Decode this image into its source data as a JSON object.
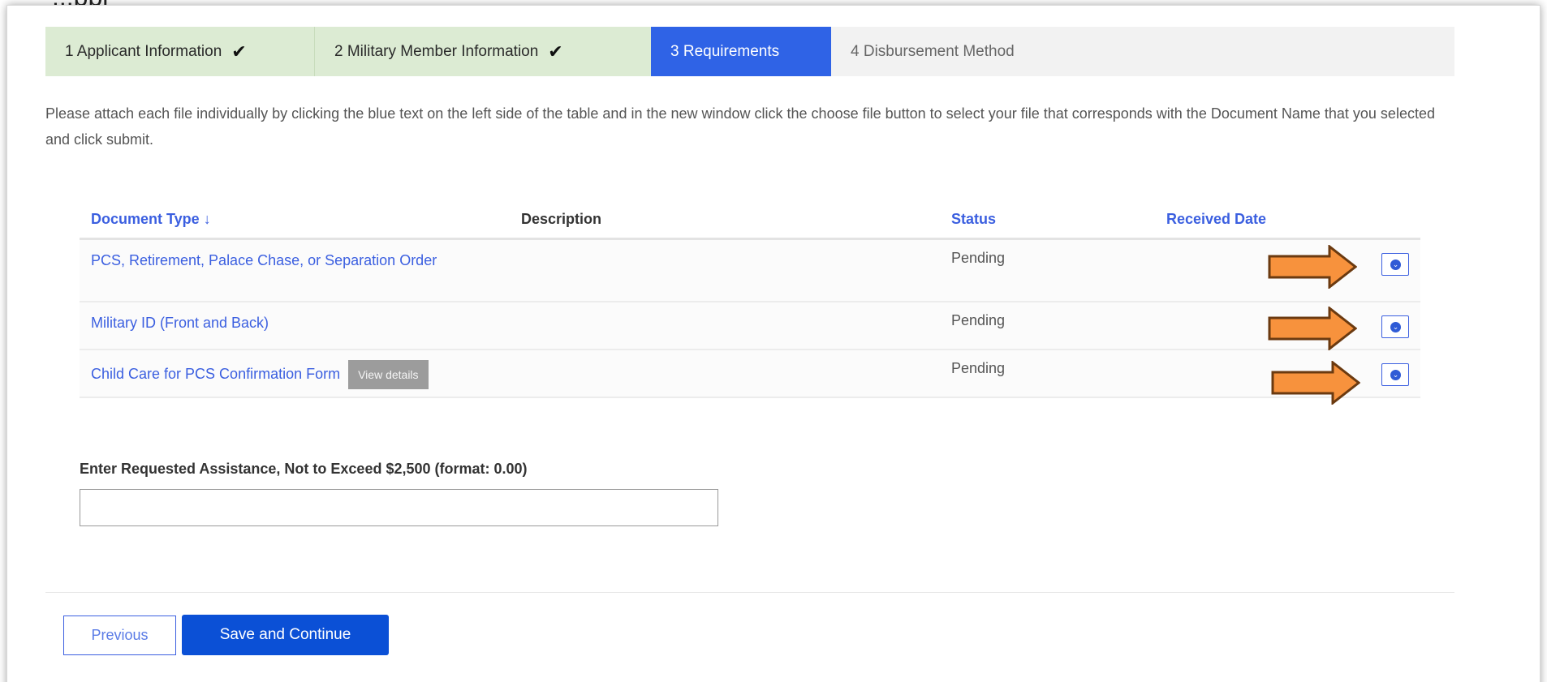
{
  "header_fragment": "...ppl",
  "steps": [
    {
      "label": "1 Applicant Information",
      "state": "done",
      "check": "✔"
    },
    {
      "label": "2 Military Member Information",
      "state": "done",
      "check": "✔"
    },
    {
      "label": "3 Requirements",
      "state": "active"
    },
    {
      "label": "4 Disbursement Method",
      "state": "todo"
    }
  ],
  "instructions": "Please attach each file individually by clicking the blue text on the left side of the table and in the new window click the choose file button to select your file that corresponds with the Document Name that you selected and click submit.",
  "table": {
    "headers": {
      "document_type": "Document Type",
      "sort_icon": "↓",
      "description": "Description",
      "status": "Status",
      "received_date": "Received Date"
    },
    "rows": [
      {
        "document_type": "PCS, Retirement, Palace Chase, or Separation Order",
        "description": "",
        "status": "Pending",
        "received_date": ""
      },
      {
        "document_type": "Military ID (Front and Back)",
        "description": "",
        "status": "Pending",
        "received_date": ""
      },
      {
        "document_type": "Child Care for PCS Confirmation Form",
        "view_details": "View details",
        "description": "",
        "status": "Pending",
        "received_date": ""
      }
    ]
  },
  "assistance": {
    "label": "Enter Requested Assistance, Not to Exceed $2,500 (format: 0.00)",
    "value": ""
  },
  "buttons": {
    "previous": "Previous",
    "save_continue": "Save and Continue"
  },
  "colors": {
    "accent_blue": "#2f63e6",
    "done_green": "#dcebd3",
    "arrow_orange": "#f7923d",
    "arrow_outline": "#6b3a10"
  }
}
